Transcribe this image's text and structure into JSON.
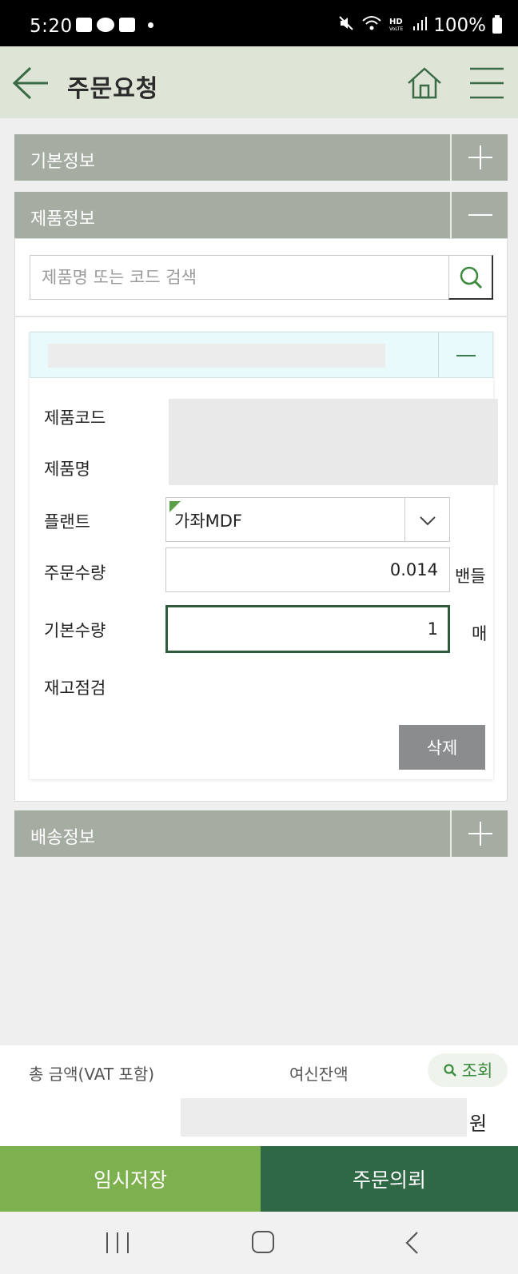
{
  "status_bar": {
    "time": "5:20",
    "battery": "100%",
    "icons": [
      "gallery-icon",
      "kakaotalk-icon",
      "message-icon",
      "mute-icon",
      "wifi-icon",
      "hd-voice-icon",
      "signal-icon",
      "battery-icon"
    ]
  },
  "header": {
    "title": "주문요청",
    "back_icon": "back-arrow-icon",
    "home_icon": "home-icon",
    "menu_icon": "hamburger-menu-icon"
  },
  "sections": {
    "basic_info": {
      "label": "기본정보",
      "state": "collapsed"
    },
    "product_info": {
      "label": "제품정보",
      "state": "expanded"
    },
    "delivery_info": {
      "label": "배송정보",
      "state": "collapsed"
    }
  },
  "product_search": {
    "placeholder": "제품명 또는 코드 검색",
    "value": ""
  },
  "product_item": {
    "fields": {
      "code_label": "제품코드",
      "name_label": "제품명",
      "plant_label": "플랜트",
      "order_qty_label": "주문수량",
      "base_qty_label": "기본수량",
      "stock_check_label": "재고점검"
    },
    "plant_value": "가좌MDF",
    "order_qty_value": "0.014",
    "order_qty_unit": "밴들",
    "base_qty_value": "1",
    "base_qty_unit": "매",
    "delete_label": "삭제"
  },
  "summary": {
    "total_label": "총 금액(VAT 포함)",
    "credit_label": "여신잔액",
    "lookup_label": "조회",
    "currency_unit": "원"
  },
  "actions": {
    "temp_save_label": "임시저장",
    "order_request_label": "주문의뢰"
  },
  "colors": {
    "header_bg": "#dee5d6",
    "section_bar": "#a5ada2",
    "temp_save_bg": "#7db04e",
    "order_bg": "#2f6844",
    "item_header_bg": "#e8fafb",
    "accent_green": "#3b8a3e"
  }
}
